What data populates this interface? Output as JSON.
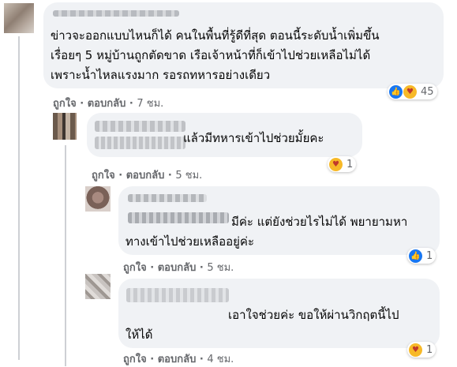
{
  "comments": [
    {
      "text_lines": [
        "ข่าวจะออกแบบไหนก็ได้ คนในพื้นที่รู้ดีที่สุด ตอนนี้ระดับน้ำเพิ่มขึ้น",
        "เรื่อยๆ 5 หมู่บ้านถูกตัดขาด เรือเจ้าหน้าที่ก็เข้าไปช่วยเหลือไม่ได้",
        "เพราะน้ำไหลแรงมาก รอรถทหารอย่างเดียว"
      ],
      "like_label": "ถูกใจ",
      "reply_label": "ตอบกลับ",
      "separator": "·",
      "time": "7 ชม.",
      "reactions": [
        "like-icon",
        "care-icon"
      ],
      "reaction_count": "45"
    },
    {
      "text_lines": [
        "แล้วมีทหารเข้าไปช่วยมั้ยคะ"
      ],
      "like_label": "ถูกใจ",
      "reply_label": "ตอบกลับ",
      "separator": "·",
      "time": "5 ชม.",
      "reactions": [
        "care-icon"
      ],
      "reaction_count": "1"
    },
    {
      "text_lines": [
        "มีค่ะ แต่ยังช่วยไรไม่ได้ พยายามหา",
        "ทางเข้าไปช่วยเหลืออยู่ค่ะ"
      ],
      "like_label": "ถูกใจ",
      "reply_label": "ตอบกลับ",
      "separator": "·",
      "time": "5 ชม.",
      "reactions": [
        "like-icon"
      ],
      "reaction_count": "1"
    },
    {
      "text_lines": [
        "เอาใจช่วยค่ะ ขอให้ผ่านวิกฤตนี้ไป",
        "ให้ได้"
      ],
      "like_label": "ถูกใจ",
      "reply_label": "ตอบกลับ",
      "separator": "·",
      "time": "4 ชม.",
      "reactions": [
        "care-icon"
      ],
      "reaction_count": "1"
    }
  ],
  "colors": {
    "bubble": "#f0f2f5",
    "meta_text": "#65676b",
    "like_blue": "#1877f2",
    "care_yellow": "#f7b928"
  }
}
